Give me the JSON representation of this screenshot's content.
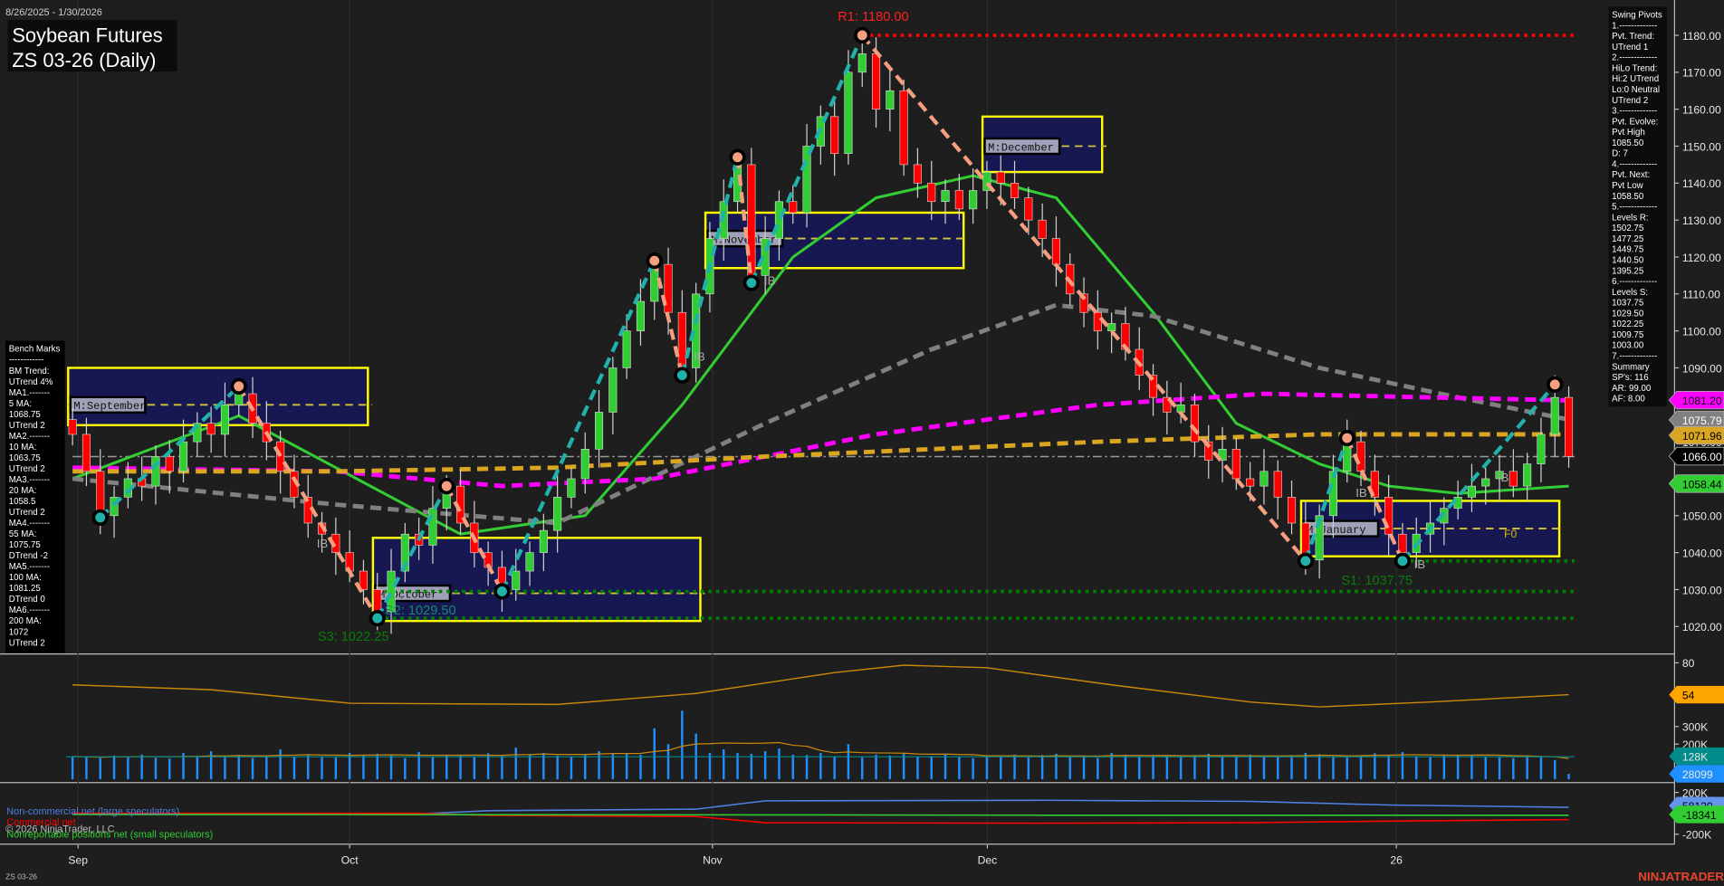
{
  "header": {
    "date_range": "8/26/2025 - 1/30/2026",
    "title_line1": "Soybean Futures",
    "title_line2": "ZS 03-26 (Daily)"
  },
  "swing_pivots": {
    "lines": [
      "Swing Pivots",
      "1.-------------",
      "Pvt. Trend:",
      "UTrend 1",
      "2.-------------",
      "HiLo Trend:",
      "Hi:2 UTrend",
      "Lo:0 Neutral",
      "UTrend 2",
      "3.-------------",
      "Pvt. Evolve:",
      "Pvt High",
      "1085.50",
      "D: 7",
      "4.-------------",
      "Pvt. Next:",
      "Pvt Low",
      "1058.50",
      "5.-------------",
      "Levels R:",
      "1502.75",
      "1477.25",
      "1449.75",
      "1440.50",
      "1395.25",
      "6.-------------",
      "Levels S:",
      "1037.75",
      "1029.50",
      "1022.25",
      "1009.75",
      "1003.00",
      "7.-------------",
      "Summary",
      "SP's: 116",
      "AR: 99.00",
      "AF: 8.00"
    ]
  },
  "bench_marks": {
    "lines": [
      "Bench Marks",
      "------------",
      "BM Trend:",
      "UTrend 4%",
      "MA1.-------",
      "5 MA:",
      "1068.75",
      "UTrend 2",
      "MA2.-------",
      "10 MA:",
      "1063.75",
      "UTrend 2",
      "MA3.-------",
      "20 MA:",
      "1058.5",
      "UTrend 2",
      "MA4.-------",
      "55 MA:",
      "1075.75",
      "DTrend -2",
      "MA5.-------",
      "100 MA:",
      "1081.25",
      "DTrend 0",
      "MA6.-------",
      "200 MA:",
      "1072",
      "UTrend 2"
    ]
  },
  "price_axis": {
    "ticks": [
      "1180.00",
      "1170.00",
      "1160.00",
      "1150.00",
      "1140.00",
      "1130.00",
      "1120.00",
      "1110.00",
      "1100.00",
      "1090.00",
      "1080.00",
      "1070.00",
      "1060.00",
      "1050.00",
      "1040.00",
      "1030.00",
      "1020.00"
    ],
    "badges": [
      {
        "label": "1081.20",
        "color": "#ff00ff",
        "text": "#000000"
      },
      {
        "label": "1075.79",
        "color": "#808080",
        "text": "#ffffff"
      },
      {
        "label": "1071.96",
        "color": "#daa520",
        "text": "#000000"
      },
      {
        "label": "1066.00",
        "color": "#000000",
        "text": "#ffffff"
      },
      {
        "label": "1058.44",
        "color": "#32cd32",
        "text": "#000000"
      }
    ]
  },
  "annotations": {
    "r1": "R1: 1180.00",
    "s1": "S1: 1037.75",
    "s2": "S2: 1029.50",
    "s3": "S3: 1022.25",
    "ib": "IB",
    "f0": "F0",
    "months": [
      "M:September",
      "M:October",
      "M:November",
      "M:December",
      "M:January"
    ]
  },
  "oscillator": {
    "ticks": [
      "80"
    ],
    "badge": "54",
    "color": "#ffa500"
  },
  "volume_panel": {
    "ticks": [
      "300K",
      "200K"
    ],
    "badges": [
      {
        "label": "128K",
        "color": "#008b8b"
      },
      {
        "label": "28099",
        "color": "#1e90ff"
      }
    ]
  },
  "cot_panel": {
    "ticks": [
      "200K",
      "-200K"
    ],
    "badges": [
      {
        "label": "58120",
        "color": "#6495ed"
      },
      {
        "label": "-18341",
        "color": "#32cd32"
      }
    ],
    "legend": [
      {
        "label": "Non-commercial net (large speculators)",
        "color": "#4f7fe0"
      },
      {
        "label": "Commercial net",
        "color": "#ff0000"
      },
      {
        "label": "Nonreportable positions net (small speculators)",
        "color": "#32cd32"
      }
    ],
    "copyright": "© 2026 NinjaTrader, LLC"
  },
  "date_axis": [
    "Sep",
    "Oct",
    "Nov",
    "Dec",
    "26"
  ],
  "footer": {
    "instrument": "ZS 03-26",
    "logo": "NINJATRADER"
  },
  "chart_data": {
    "type": "candlestick",
    "title": "Soybean Futures ZS 03-26 (Daily)",
    "ylim": [
      1015,
      1185
    ],
    "closes": [
      1072,
      1062,
      1050,
      1055,
      1060,
      1058,
      1066,
      1062,
      1070,
      1075,
      1072,
      1080,
      1083,
      1075,
      1070,
      1062,
      1055,
      1048,
      1045,
      1040,
      1035,
      1030,
      1024,
      1035,
      1045,
      1042,
      1052,
      1058,
      1048,
      1040,
      1036,
      1030,
      1035,
      1040,
      1046,
      1055,
      1060,
      1068,
      1078,
      1090,
      1100,
      1108,
      1118,
      1105,
      1090,
      1110,
      1125,
      1135,
      1145,
      1115,
      1125,
      1135,
      1132,
      1150,
      1158,
      1148,
      1170,
      1175,
      1160,
      1165,
      1145,
      1140,
      1135,
      1138,
      1133,
      1138,
      1143,
      1140,
      1136,
      1130,
      1125,
      1118,
      1110,
      1105,
      1100,
      1102,
      1095,
      1088,
      1082,
      1078,
      1080,
      1070,
      1065,
      1068,
      1060,
      1058,
      1062,
      1055,
      1048,
      1038,
      1050,
      1062,
      1070,
      1062,
      1055,
      1045,
      1040,
      1045,
      1048,
      1052,
      1055,
      1058,
      1060,
      1062,
      1058,
      1064,
      1072,
      1082,
      1066
    ],
    "volume_k": [
      130,
      125,
      120,
      135,
      128,
      140,
      122,
      118,
      150,
      132,
      160,
      126,
      138,
      121,
      133,
      170,
      128,
      142,
      131,
      125,
      150,
      138,
      145,
      134,
      120,
      155,
      128,
      140,
      136,
      126,
      148,
      132,
      180,
      140,
      150,
      135,
      128,
      138,
      160,
      150,
      150,
      140,
      290,
      200,
      390,
      260,
      150,
      170,
      150,
      145,
      160,
      175,
      140,
      138,
      150,
      130,
      200,
      125,
      140,
      135,
      150,
      128,
      132,
      142,
      130,
      120,
      135,
      128,
      140,
      125,
      138,
      145,
      130,
      136,
      122,
      150,
      140,
      128,
      135,
      132,
      126,
      138,
      145,
      130,
      125,
      140,
      132,
      128,
      138,
      150,
      142,
      130,
      125,
      135,
      148,
      140,
      155,
      132,
      128,
      140,
      135,
      138,
      130,
      125,
      120,
      128,
      126,
      110,
      30
    ],
    "pivots": [
      {
        "bar": 2,
        "price": 1049.5,
        "type": "low"
      },
      {
        "bar": 12,
        "price": 1085,
        "type": "high"
      },
      {
        "bar": 22,
        "price": 1022.25,
        "type": "low"
      },
      {
        "bar": 27,
        "price": 1058,
        "type": "high"
      },
      {
        "bar": 31,
        "price": 1029.5,
        "type": "low"
      },
      {
        "bar": 42,
        "price": 1119,
        "type": "high"
      },
      {
        "bar": 44,
        "price": 1088,
        "type": "low"
      },
      {
        "bar": 48,
        "price": 1147,
        "type": "high"
      },
      {
        "bar": 49,
        "price": 1113,
        "type": "low"
      },
      {
        "bar": 57,
        "price": 1180,
        "type": "high"
      },
      {
        "bar": 89,
        "price": 1037.75,
        "type": "low"
      },
      {
        "bar": 92,
        "price": 1071,
        "type": "high"
      },
      {
        "bar": 96,
        "price": 1037.75,
        "type": "low"
      },
      {
        "bar": 107,
        "price": 1085.5,
        "type": "high"
      }
    ],
    "moving_averages": [
      {
        "name": "20 MA",
        "color": "#32cd32",
        "dash": false,
        "points": [
          [
            0,
            1060
          ],
          [
            12,
            1077
          ],
          [
            19,
            1063
          ],
          [
            28,
            1045
          ],
          [
            37,
            1050
          ],
          [
            44,
            1080
          ],
          [
            52,
            1120
          ],
          [
            58,
            1136
          ],
          [
            65,
            1142
          ],
          [
            71,
            1136
          ],
          [
            78,
            1105
          ],
          [
            84,
            1075
          ],
          [
            90,
            1064
          ],
          [
            95,
            1058
          ],
          [
            100,
            1056
          ],
          [
            108,
            1058
          ]
        ]
      },
      {
        "name": "55 MA",
        "color": "#808080",
        "dash": true,
        "points": [
          [
            0,
            1060
          ],
          [
            19,
            1053
          ],
          [
            35,
            1048
          ],
          [
            50,
            1075
          ],
          [
            62,
            1095
          ],
          [
            71,
            1107
          ],
          [
            78,
            1104
          ],
          [
            90,
            1090
          ],
          [
            100,
            1082
          ],
          [
            108,
            1076
          ]
        ]
      },
      {
        "name": "100 MA",
        "color": "#ff00ff",
        "dash": true,
        "points": [
          [
            0,
            1063
          ],
          [
            19,
            1062
          ],
          [
            31,
            1058
          ],
          [
            42,
            1060
          ],
          [
            58,
            1072
          ],
          [
            74,
            1080
          ],
          [
            86,
            1083
          ],
          [
            98,
            1082
          ],
          [
            108,
            1081.2
          ]
        ]
      },
      {
        "name": "200 MA",
        "color": "#daa520",
        "dash": true,
        "points": [
          [
            0,
            1062
          ],
          [
            19,
            1062
          ],
          [
            35,
            1063
          ],
          [
            50,
            1066
          ],
          [
            74,
            1070
          ],
          [
            90,
            1072
          ],
          [
            108,
            1072
          ]
        ]
      }
    ],
    "monthly_ranges": [
      {
        "name": "M:September",
        "from": 0,
        "to": 21,
        "high": 1090,
        "low": 1074.5,
        "mid": 1080
      },
      {
        "name": "M:October",
        "from": 22,
        "to": 45,
        "high": 1044,
        "low": 1021.5,
        "mid": 1029
      },
      {
        "name": "M:November",
        "from": 46,
        "to": 64,
        "high": 1132,
        "low": 1117,
        "mid": 1125
      },
      {
        "name": "M:December",
        "from": 66,
        "to": 74,
        "high": 1158,
        "low": 1143,
        "mid": 1150
      },
      {
        "name": "M:January",
        "from": 89,
        "to": 107,
        "high": 1054,
        "low": 1039,
        "mid": 1046.5
      }
    ],
    "levels": [
      {
        "name": "R1",
        "price": 1180,
        "color": "#ff0000",
        "from": 57
      },
      {
        "name": "S1",
        "price": 1037.75,
        "color": "#008000",
        "from": 96
      },
      {
        "name": "S2",
        "price": 1029.5,
        "color": "#008000",
        "from": 22
      },
      {
        "name": "S3",
        "price": 1022.25,
        "color": "#008000",
        "from": 22
      },
      {
        "name": "last",
        "price": 1066,
        "color": "#999999",
        "from": 0
      }
    ],
    "oscillator_points": [
      [
        0,
        62
      ],
      [
        10,
        58
      ],
      [
        20,
        47
      ],
      [
        35,
        46
      ],
      [
        45,
        55
      ],
      [
        55,
        72
      ],
      [
        60,
        78
      ],
      [
        66,
        76
      ],
      [
        75,
        62
      ],
      [
        85,
        48
      ],
      [
        90,
        44
      ],
      [
        98,
        48
      ],
      [
        108,
        54
      ]
    ],
    "cot_series": [
      {
        "name": "Non-commercial net",
        "color": "#4f7fe0",
        "points": [
          [
            0,
            -5
          ],
          [
            25,
            -5
          ],
          [
            30,
            25
          ],
          [
            45,
            40
          ],
          [
            50,
            120
          ],
          [
            70,
            125
          ],
          [
            85,
            115
          ],
          [
            95,
            80
          ],
          [
            108,
            58
          ]
        ]
      },
      {
        "name": "Commercial net",
        "color": "#ff0000",
        "points": [
          [
            0,
            0
          ],
          [
            25,
            0
          ],
          [
            30,
            -20
          ],
          [
            45,
            -30
          ],
          [
            50,
            -90
          ],
          [
            70,
            -95
          ],
          [
            85,
            -90
          ],
          [
            95,
            -75
          ],
          [
            108,
            -60
          ]
        ]
      },
      {
        "name": "Nonreportable net",
        "color": "#32cd32",
        "points": [
          [
            0,
            -10
          ],
          [
            50,
            -15
          ],
          [
            70,
            -18
          ],
          [
            108,
            -18
          ]
        ]
      }
    ]
  }
}
